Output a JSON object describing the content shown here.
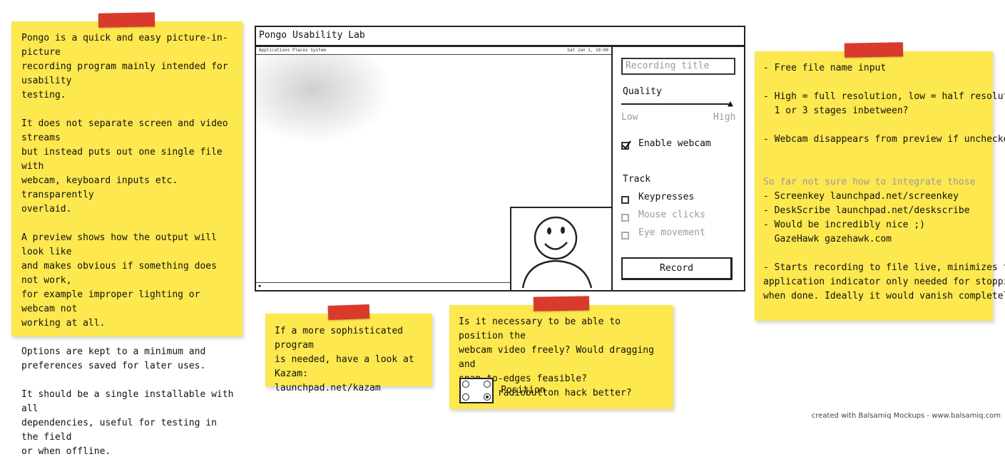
{
  "left_note": {
    "paragraphs": [
      "Pongo is a quick and easy picture-in-picture\nrecording program mainly intended for usability\ntesting.",
      "It does not separate screen and video streams\nbut instead puts out one single file with\nwebcam, keyboard inputs etc. transparently\noverlaid.",
      "A preview shows how the output will look like\nand makes obvious if something does not work,\nfor example improper lighting or webcam not\nworking at all.",
      "Options are kept to a minimum and\npreferences saved for later uses.",
      "It should be a single installable with all\ndependencies, useful for testing in the field\nor when offline."
    ]
  },
  "window": {
    "title": "Pongo Usability Lab",
    "tinybar_left": "Applications  Places  System",
    "tinybar_right": "Sat Jan 1, 10:00"
  },
  "panel": {
    "title_placeholder": "Recording title",
    "quality_label": "Quality",
    "low_label": "Low",
    "high_label": "High",
    "enable_webcam_label": "Enable webcam",
    "enable_webcam_checked": true,
    "track_label": "Track",
    "keypresses_label": "Keypresses",
    "mouse_clicks_label": "Mouse clicks",
    "eye_movement_label": "Eye movement",
    "record_label": "Record",
    "quality_value": 1.0
  },
  "right_note": {
    "lines": [
      "- Free file name input",
      "",
      "- High = full resolution, low = half resolution.",
      "  1 or 3 stages inbetween?",
      "",
      "- Webcam disappears from preview if unchecked",
      "",
      "",
      "So far not sure how to integrate those",
      "- Screenkey launchpad.net/screenkey",
      "- DeskScribe launchpad.net/deskscribe",
      "- Would be incredibly nice ;)",
      "  GazeHawk gazehawk.com",
      "",
      "- Starts recording to file live, minimizes to",
      "application indicator only needed for stopping",
      "when done. Ideally it would vanish completely."
    ]
  },
  "kazam_note": {
    "text": "If a more sophisticated program\nis needed, have a look at Kazam:\nlaunchpad.net/kazam"
  },
  "position_note": {
    "text": "Is it necessary to be able to position the\nwebcam video freely? Would dragging and\nsnap-to-edges feasible?\nIs the radiobutton hack better?",
    "position_label": "Position"
  },
  "footer": "created with Balsamiq Mockups - www.balsamiq.com",
  "colors": {
    "note": "#fde84f",
    "tape": "#d93a2c"
  }
}
